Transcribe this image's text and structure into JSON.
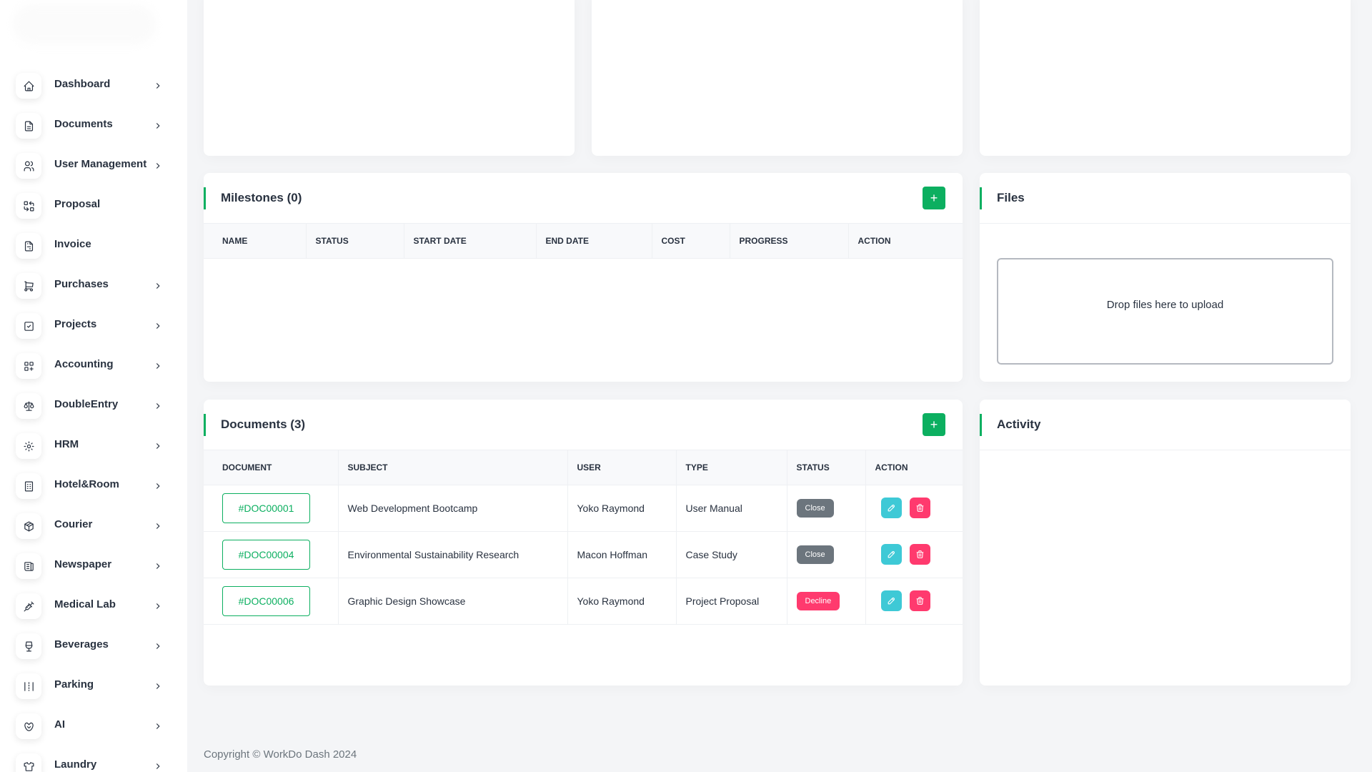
{
  "sidebar": {
    "items": [
      {
        "label": "Dashboard",
        "icon": "home-icon",
        "has_submenu": true
      },
      {
        "label": "Documents",
        "icon": "document-icon",
        "has_submenu": true
      },
      {
        "label": "User Management",
        "icon": "users-icon",
        "has_submenu": true
      },
      {
        "label": "Proposal",
        "icon": "replace-icon",
        "has_submenu": false
      },
      {
        "label": "Invoice",
        "icon": "file-invoice-icon",
        "has_submenu": false
      },
      {
        "label": "Purchases",
        "icon": "cart-icon",
        "has_submenu": true
      },
      {
        "label": "Projects",
        "icon": "square-check-icon",
        "has_submenu": true
      },
      {
        "label": "Accounting",
        "icon": "layout-grid-add-icon",
        "has_submenu": true
      },
      {
        "label": "DoubleEntry",
        "icon": "scale-icon",
        "has_submenu": true
      },
      {
        "label": "HRM",
        "icon": "circle-dots-icon",
        "has_submenu": true
      },
      {
        "label": "Hotel&Room",
        "icon": "building-icon",
        "has_submenu": true
      },
      {
        "label": "Courier",
        "icon": "package-icon",
        "has_submenu": true
      },
      {
        "label": "Newspaper",
        "icon": "news-icon",
        "has_submenu": true
      },
      {
        "label": "Medical Lab",
        "icon": "vaccine-icon",
        "has_submenu": true
      },
      {
        "label": "Beverages",
        "icon": "glass-icon",
        "has_submenu": true
      },
      {
        "label": "Parking",
        "icon": "parking-icon",
        "has_submenu": true
      },
      {
        "label": "AI",
        "icon": "brain-icon",
        "has_submenu": true
      },
      {
        "label": "Laundry",
        "icon": "shirt-icon",
        "has_submenu": true
      }
    ]
  },
  "milestones": {
    "title": "Milestones (0)",
    "add_label": "+",
    "columns": [
      "NAME",
      "STATUS",
      "START DATE",
      "END DATE",
      "COST",
      "PROGRESS",
      "ACTION"
    ]
  },
  "files": {
    "title": "Files",
    "dropzone_text": "Drop files here to upload"
  },
  "documents": {
    "title": "Documents (3)",
    "add_label": "+",
    "columns": [
      "DOCUMENT",
      "SUBJECT",
      "USER",
      "TYPE",
      "STATUS",
      "ACTION"
    ],
    "rows": [
      {
        "id": "#DOC00001",
        "subject": "Web Development Bootcamp",
        "user": "Yoko Raymond",
        "type": "User Manual",
        "status": "Close"
      },
      {
        "id": "#DOC00004",
        "subject": "Environmental Sustainability Research",
        "user": "Macon Hoffman",
        "type": "Case Study",
        "status": "Close"
      },
      {
        "id": "#DOC00006",
        "subject": "Graphic Design Showcase",
        "user": "Yoko Raymond",
        "type": "Project Proposal",
        "status": "Decline"
      }
    ]
  },
  "activity": {
    "title": "Activity"
  },
  "footer": {
    "copyright": "Copyright © WorkDo Dash 2024"
  },
  "colors": {
    "accent": "#0caf60",
    "edit": "#3ec9d6",
    "danger": "#ff3a6e",
    "neutral": "#6c757d"
  }
}
